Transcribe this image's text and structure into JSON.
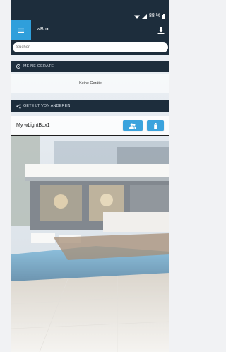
{
  "statusbar": {
    "battery_text": "88 %",
    "icons": [
      "wifi-icon",
      "cell-signal-icon",
      "battery-icon"
    ]
  },
  "appbar": {
    "title": "wBox",
    "menu_icon": "hamburger-menu-icon",
    "action_icon": "download-icon"
  },
  "search": {
    "placeholder": "Suchen",
    "value": ""
  },
  "sections": {
    "my_devices": {
      "title": "MEINE GERÄTE",
      "icon": "device-icon",
      "empty_text": "Keine Geräte"
    },
    "shared": {
      "title": "GETEILT VON ANDEREN",
      "icon": "share-icon",
      "devices": [
        {
          "name": "My wLightBox1",
          "buttons": [
            "share-users-icon",
            "trash-icon"
          ]
        }
      ]
    }
  },
  "colors": {
    "header_bg": "#1d2d3c",
    "accent": "#2f9fdb",
    "button": "#3ba3dd"
  }
}
